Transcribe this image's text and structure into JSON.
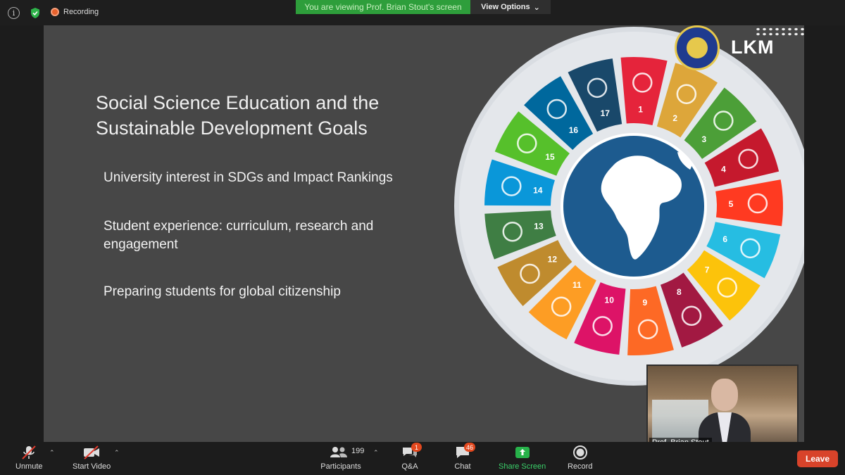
{
  "top_bar": {
    "recording_label": "Recording",
    "viewing_banner": "You are viewing Prof. Brian Stout's screen",
    "view_options_label": "View Options",
    "info_icon": "info-icon",
    "shield_icon": "shield-icon"
  },
  "slide": {
    "title": "Social Science Education and the Sustainable Development Goals",
    "bullets": [
      "University interest in SDGs and Impact Rankings",
      "Student experience: curriculum, research and engagement",
      "Preparing students for global citizenship"
    ],
    "logo_text": "LKM",
    "sdg_wheel": [
      {
        "number": "1",
        "color": "#e5243b"
      },
      {
        "number": "2",
        "color": "#dda63a"
      },
      {
        "number": "3",
        "color": "#4c9f38"
      },
      {
        "number": "4",
        "color": "#c5192d"
      },
      {
        "number": "5",
        "color": "#ff3a21"
      },
      {
        "number": "6",
        "color": "#26bde2"
      },
      {
        "number": "7",
        "color": "#fcc30b"
      },
      {
        "number": "8",
        "color": "#a21942"
      },
      {
        "number": "9",
        "color": "#fd6925"
      },
      {
        "number": "10",
        "color": "#dd1367"
      },
      {
        "number": "11",
        "color": "#fd9d24"
      },
      {
        "number": "12",
        "color": "#bf8b2e"
      },
      {
        "number": "13",
        "color": "#3f7e44"
      },
      {
        "number": "14",
        "color": "#0a97d9"
      },
      {
        "number": "15",
        "color": "#56c02b"
      },
      {
        "number": "16",
        "color": "#00689d"
      },
      {
        "number": "17",
        "color": "#19486a"
      }
    ]
  },
  "speaker": {
    "name": "Prof. Brian Stout"
  },
  "toolbar": {
    "unmute": "Unmute",
    "start_video": "Start Video",
    "participants": "Participants",
    "participant_count": "199",
    "qa": "Q&A",
    "qa_badge": "1",
    "chat": "Chat",
    "chat_badge": "46",
    "share_screen": "Share Screen",
    "record": "Record",
    "leave": "Leave"
  }
}
